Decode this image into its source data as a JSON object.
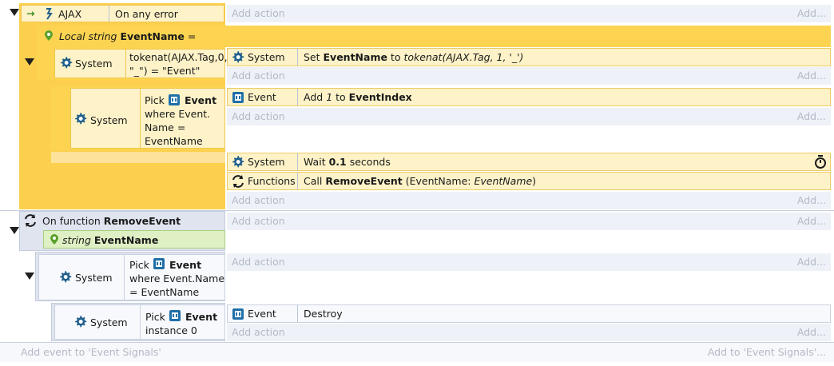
{
  "event1": {
    "plugin": "AJAX",
    "trigger": "On any error",
    "add_action": "Add action",
    "add_short": "Add..."
  },
  "sub1": {
    "local_var_kw": "Local string",
    "local_var_name": "EventName",
    "local_var_suffix": " =",
    "cond_object": "System",
    "cond_text_1": "tokenat(AJAX.Tag,0,",
    "cond_text_2": "\"_\") = \"Event\"",
    "action_object": "System",
    "action_prefix": "Set",
    "action_var": "EventName",
    "action_mid": "to",
    "action_expr": "tokenat(AJAX.Tag, 1, '_')",
    "add_action": "Add action",
    "add_short": "Add..."
  },
  "sub2": {
    "cond_object": "System",
    "pick": "Pick",
    "pick_obj": "Event",
    "where_1": "where Event.",
    "where_2": "Name =",
    "where_3": "EventName",
    "action_object": "Event",
    "action_prefix": "Add",
    "action_num": "1",
    "action_mid": "to",
    "action_var": "EventIndex",
    "add_action": "Add action",
    "add_short": "Add..."
  },
  "sub3": {
    "action1_object": "System",
    "action1_prefix": "Wait",
    "action1_value": "0.1",
    "action1_suffix": "seconds",
    "action2_object": "Functions",
    "action2_prefix": "Call",
    "action2_fn": "RemoveEvent",
    "action2_params_open": "(EventName: ",
    "action2_param_val": "EventName",
    "action2_params_close": ")",
    "add_action": "Add action",
    "add_short": "Add..."
  },
  "function": {
    "label": "On function",
    "name": "RemoveEvent",
    "param_kw": "string",
    "param_name": "EventName",
    "add_action": "Add action",
    "add_short": "Add..."
  },
  "fsub1": {
    "cond_object": "System",
    "pick": "Pick",
    "pick_obj": "Event",
    "where_1": "where Event.Name",
    "where_2": "= EventName",
    "add_action": "Add action",
    "add_short": "Add..."
  },
  "fsub2": {
    "cond_object": "System",
    "pick": "Pick",
    "pick_obj": "Event",
    "instance": "instance 0",
    "action_object": "Event",
    "action_text": "Destroy",
    "add_action": "Add action",
    "add_short": "Add..."
  },
  "footer": {
    "add_event": "Add event to 'Event Signals'",
    "add_short": "Add to 'Event Signals'..."
  },
  "colors": {
    "yellow_band": "#fde9a6",
    "yellow_strong": "#fcd04e",
    "blue_band": "#dfe4ef",
    "gear": "#1f5f8b",
    "green_param": "#dff0c4"
  }
}
